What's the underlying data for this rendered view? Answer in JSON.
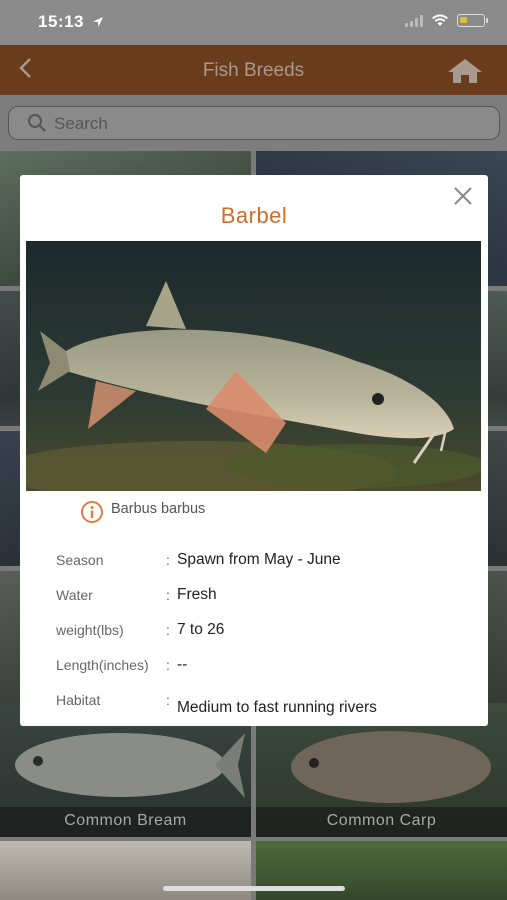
{
  "status_bar": {
    "time": "15:13"
  },
  "nav": {
    "title": "Fish Breeds"
  },
  "search": {
    "placeholder": "Search"
  },
  "grid_tiles": [
    {
      "label": "Common Bream"
    },
    {
      "label": "Common Carp"
    }
  ],
  "modal": {
    "title": "Barbel",
    "scientific_name": "Barbus barbus",
    "details": [
      {
        "label": "Season",
        "value": "Spawn from May - June"
      },
      {
        "label": "Water",
        "value": "Fresh"
      },
      {
        "label": "weight(lbs)",
        "value": "7 to 26"
      },
      {
        "label": "Length(inches)",
        "value": "--"
      },
      {
        "label": "Habitat",
        "value": "Medium to fast running rivers"
      }
    ]
  },
  "colors": {
    "nav_bar": "#6b3c1c",
    "title_accent": "#d26d2c",
    "info_icon": "#e07c3c"
  }
}
